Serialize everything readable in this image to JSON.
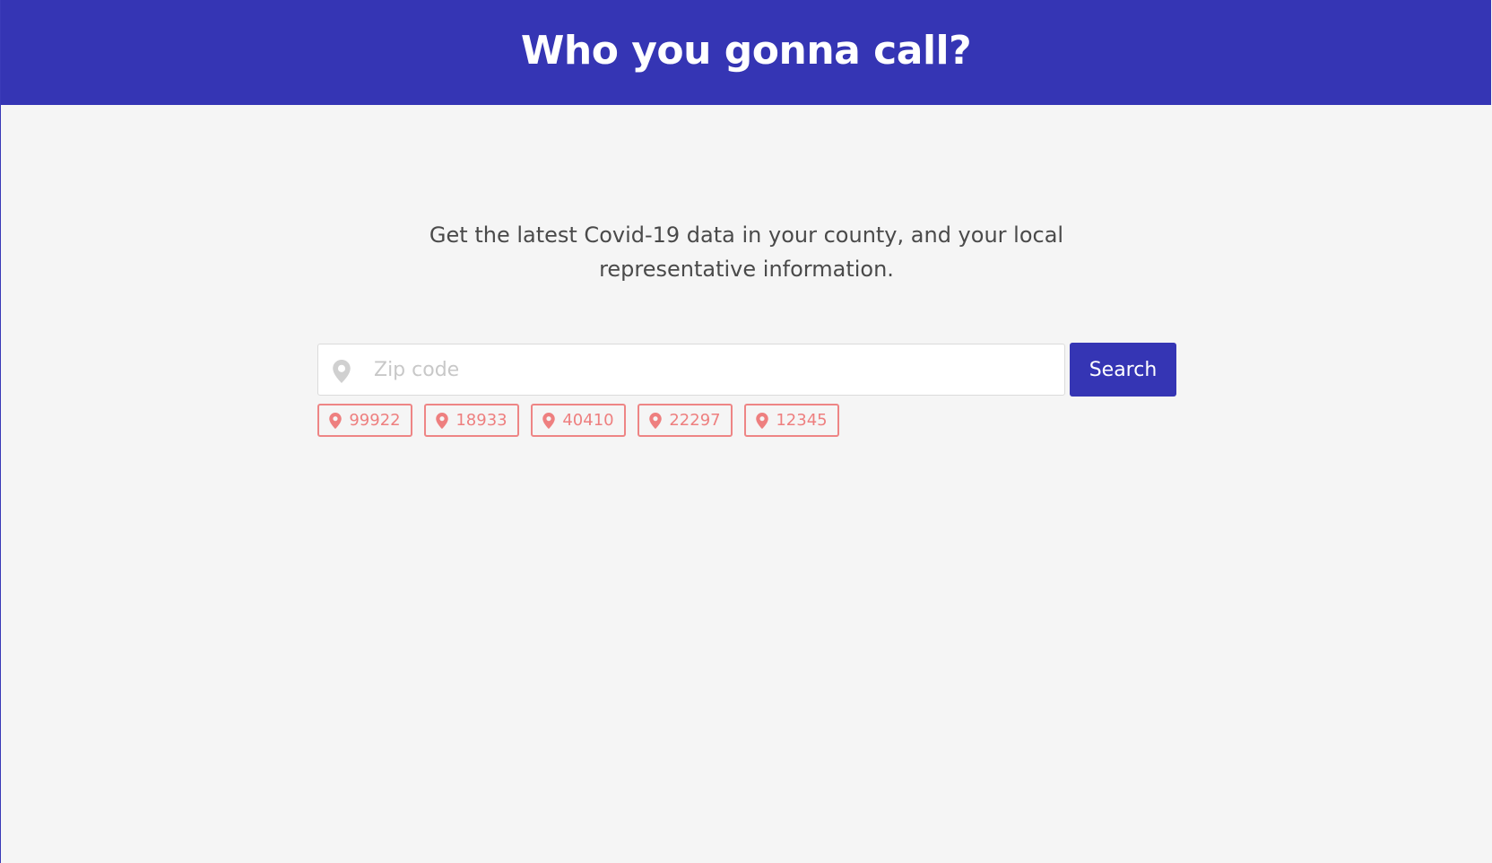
{
  "header": {
    "title": "Who you gonna call?",
    "background": "#3535b4"
  },
  "intro": {
    "text": "Get the latest Covid-19 data in your county, and your local representative information."
  },
  "search": {
    "placeholder": "Zip code",
    "value": "",
    "icon": "map-marker-icon",
    "button_label": "Search"
  },
  "suggestions": [
    {
      "zip": "99922",
      "icon": "map-marker-icon"
    },
    {
      "zip": "18933",
      "icon": "map-marker-icon"
    },
    {
      "zip": "40410",
      "icon": "map-marker-icon"
    },
    {
      "zip": "22297",
      "icon": "map-marker-icon"
    },
    {
      "zip": "12345",
      "icon": "map-marker-icon"
    }
  ],
  "colors": {
    "accent": "#3535b4",
    "chip": "#ee8585",
    "page_bg": "#f5f5f5"
  }
}
